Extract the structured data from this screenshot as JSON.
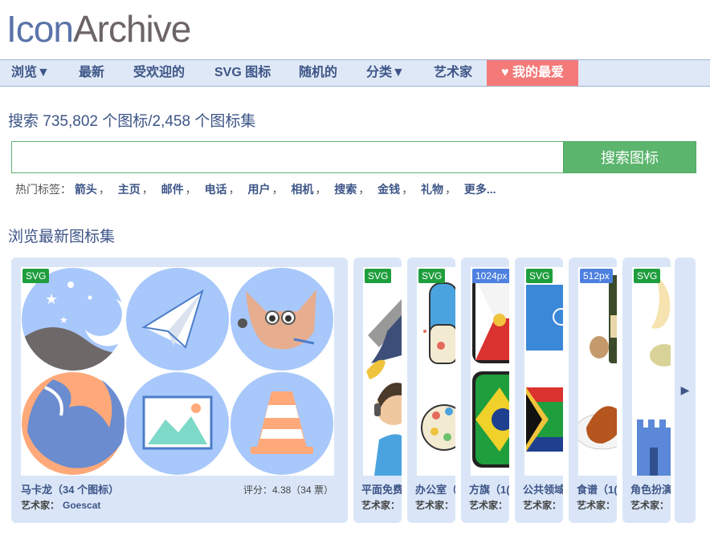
{
  "logo": {
    "part1": "Icon",
    "part2": "Archive"
  },
  "nav": {
    "items": [
      "浏览▼",
      "最新",
      "受欢迎的",
      "SVG 图标",
      "随机的",
      "分类▼",
      "艺术家"
    ],
    "favorites": "♥ 我的最爱"
  },
  "headline": "搜索 735,802 个图标/2,458 个图标集",
  "search": {
    "value": "",
    "placeholder": "",
    "button": "搜索图标"
  },
  "tags": {
    "label": "热门标签：",
    "items": [
      "箭头",
      "主页",
      "邮件",
      "电话",
      "用户",
      "相机",
      "搜索",
      "金钱",
      "礼物"
    ],
    "separator": "，",
    "more": "更多..."
  },
  "section_title": "浏览最新图标集",
  "cards": [
    {
      "badge": "SVG",
      "title": "马卡龙（34 个图标）",
      "artist_label": "艺术家：",
      "artist": "Goescat",
      "rating": "评分：4.38（34 票）"
    },
    {
      "badge": "SVG",
      "title": "平面免费",
      "artist_label": "艺术家："
    },
    {
      "badge": "SVG",
      "title": "办公室（",
      "artist_label": "艺术家："
    },
    {
      "badge": "1024px",
      "title": "方旗（1(",
      "artist_label": "艺术家："
    },
    {
      "badge": "SVG",
      "title": "公共领域",
      "artist_label": "艺术家："
    },
    {
      "badge": "512px",
      "title": "食谱（1(",
      "artist_label": "艺术家："
    },
    {
      "badge": "SVG",
      "title": "角色扮演",
      "artist_label": "艺术家："
    }
  ],
  "next_arrow": "▶",
  "colors": {
    "nav_bg": "#dfe8f6",
    "accent_blue": "#3d5587",
    "search_green": "#5bb56d",
    "favorites_red": "#f47a7a",
    "card_bg": "#dae6f8"
  }
}
